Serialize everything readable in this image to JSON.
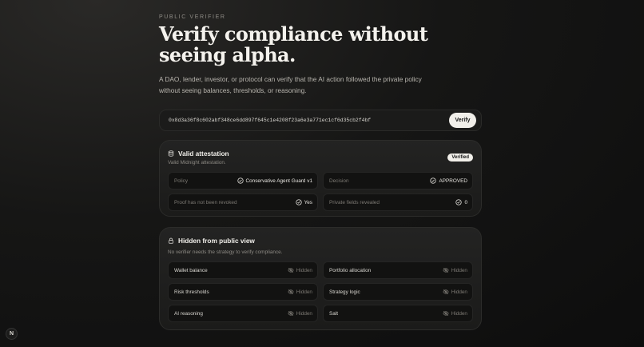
{
  "eyebrow": "PUBLIC VERIFIER",
  "headline": "Verify compliance without seeing alpha.",
  "lede": "A DAO, lender, investor, or protocol can verify that the AI action followed the private policy without seeing balances, thresholds, or reasoning.",
  "search": {
    "value": "0x8d3a36f8c602abf348ce6dd897f645c1e4208f23a6e3a771ec1cf6d35cb2f4bf",
    "button": "Verify"
  },
  "attestation": {
    "title": "Valid attestation",
    "subtitle": "Valid Midnight attestation.",
    "badge": "Verified",
    "fields": [
      {
        "label": "Policy",
        "value": "Conservative Agent Guard v1",
        "icon": "check-circle-icon"
      },
      {
        "label": "Decision",
        "value": "APPROVED",
        "icon": "check-circle-icon"
      },
      {
        "label": "Proof has not been revoked",
        "value": "Yes",
        "icon": "check-circle-icon"
      },
      {
        "label": "Private fields revealed",
        "value": "0",
        "icon": "check-circle-icon"
      }
    ]
  },
  "hidden": {
    "title": "Hidden from public view",
    "subtitle": "No verifier needs the strategy to verify compliance.",
    "fields": [
      {
        "label": "Wallet balance",
        "value": "Hidden"
      },
      {
        "label": "Portfolio allocation",
        "value": "Hidden"
      },
      {
        "label": "Risk thresholds",
        "value": "Hidden"
      },
      {
        "label": "Strategy logic",
        "value": "Hidden"
      },
      {
        "label": "AI reasoning",
        "value": "Hidden"
      },
      {
        "label": "Salt",
        "value": "Hidden"
      }
    ]
  },
  "corner_badge": "N"
}
